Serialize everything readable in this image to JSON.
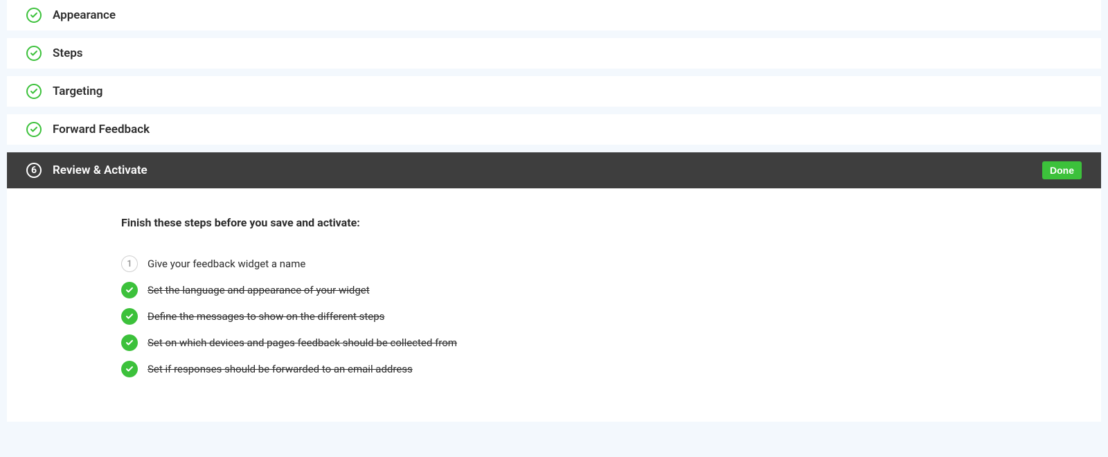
{
  "steps": {
    "appearance": {
      "label": "Appearance"
    },
    "steps": {
      "label": "Steps"
    },
    "targeting": {
      "label": "Targeting"
    },
    "forward": {
      "label": "Forward Feedback"
    }
  },
  "active": {
    "number": "6",
    "label": "Review & Activate",
    "doneLabel": "Done"
  },
  "content": {
    "heading": "Finish these steps before you save and activate:",
    "item1": {
      "number": "1",
      "text": "Give your feedback widget a name"
    },
    "item2": {
      "text": "Set the language and appearance of your widget"
    },
    "item3": {
      "text": "Define the messages to show on the different steps"
    },
    "item4": {
      "text": "Set on which devices and pages feedback should be collected from"
    },
    "item5": {
      "text": "Set if responses should be forwarded to an email address"
    }
  }
}
